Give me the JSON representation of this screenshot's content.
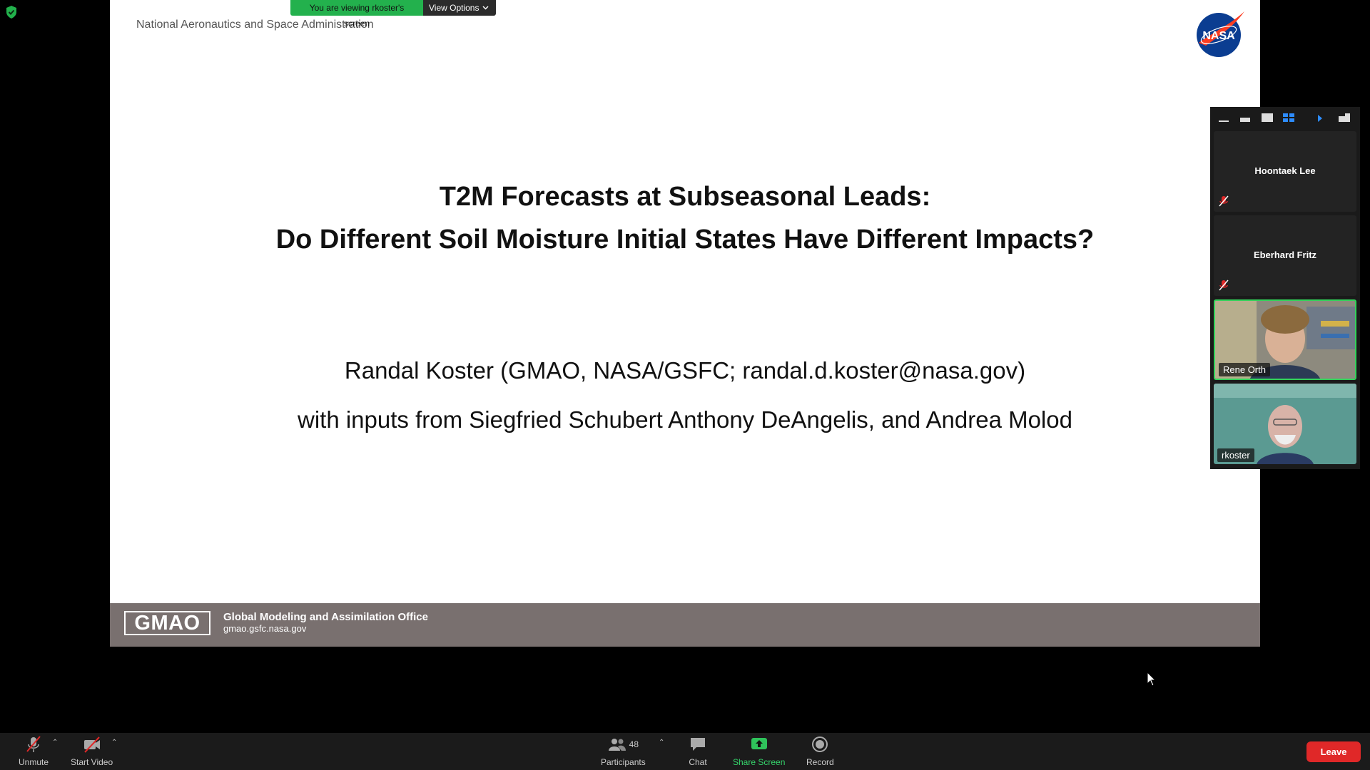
{
  "share_banner": {
    "viewing_text": "You are viewing rkoster's screen",
    "view_options_label": "View Options"
  },
  "slide": {
    "agency": "National Aeronautics and Space Administration",
    "nasa_logo_text": "NASA",
    "title_line1": "T2M Forecasts at Subseasonal Leads:",
    "title_line2": "Do Different Soil Moisture Initial States Have Different Impacts?",
    "author_line1": "Randal Koster (GMAO, NASA/GSFC; randal.d.koster@nasa.gov)",
    "author_line2": "with inputs from Siegfried Schubert Anthony DeAngelis, and Andrea Molod",
    "footer": {
      "logo_text": "GMAO",
      "office_name": "Global Modeling and Assimilation Office",
      "url": "gmao.gsfc.nasa.gov"
    }
  },
  "participants_panel": {
    "tiles": [
      {
        "name": "Hoontaek Lee",
        "muted": true,
        "video": false
      },
      {
        "name": "Eberhard Fritz",
        "muted": true,
        "video": false
      },
      {
        "name": "Rene Orth",
        "muted": false,
        "video": true,
        "active_speaker": true
      },
      {
        "name": "rkoster",
        "muted": false,
        "video": true
      }
    ]
  },
  "toolbar": {
    "unmute_label": "Unmute",
    "start_video_label": "Start Video",
    "participants_label": "Participants",
    "participants_count": "48",
    "chat_label": "Chat",
    "share_screen_label": "Share Screen",
    "record_label": "Record",
    "leave_label": "Leave"
  },
  "colors": {
    "share_green": "#23b14d",
    "leave_red": "#e02828",
    "footer_gray": "#79706f",
    "active_speaker": "#33d35a"
  }
}
